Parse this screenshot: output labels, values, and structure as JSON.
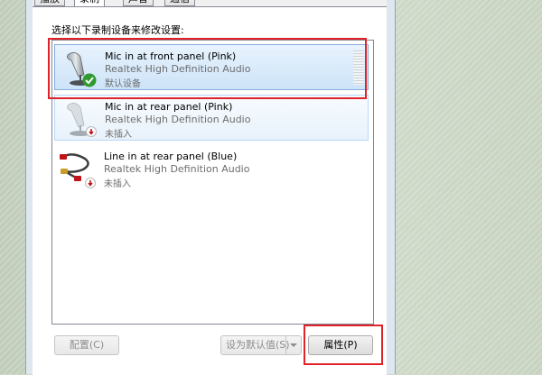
{
  "tabs": [
    {
      "label": "播放"
    },
    {
      "label": "录制"
    },
    {
      "label": "声音"
    },
    {
      "label": "通信"
    }
  ],
  "instruction": "选择以下录制设备来修改设置:",
  "devices": [
    {
      "name": "Mic in at front panel (Pink)",
      "driver": "Realtek High Definition Audio",
      "status": "默认设备",
      "icon": "microphone-icon",
      "badge": "default-check-icon"
    },
    {
      "name": "Mic in at rear panel (Pink)",
      "driver": "Realtek High Definition Audio",
      "status": "未插入",
      "icon": "microphone-icon",
      "badge": "unplugged-icon"
    },
    {
      "name": "Line in at rear panel (Blue)",
      "driver": "Realtek High Definition Audio",
      "status": "未插入",
      "icon": "line-in-cable-icon",
      "badge": "unplugged-icon"
    }
  ],
  "buttons": {
    "configure": "配置(C)",
    "set_default": "设为默认值(S)",
    "properties": "属性(P)"
  },
  "colors": {
    "highlight": "#e0222a",
    "selection": "#cde3f8"
  }
}
